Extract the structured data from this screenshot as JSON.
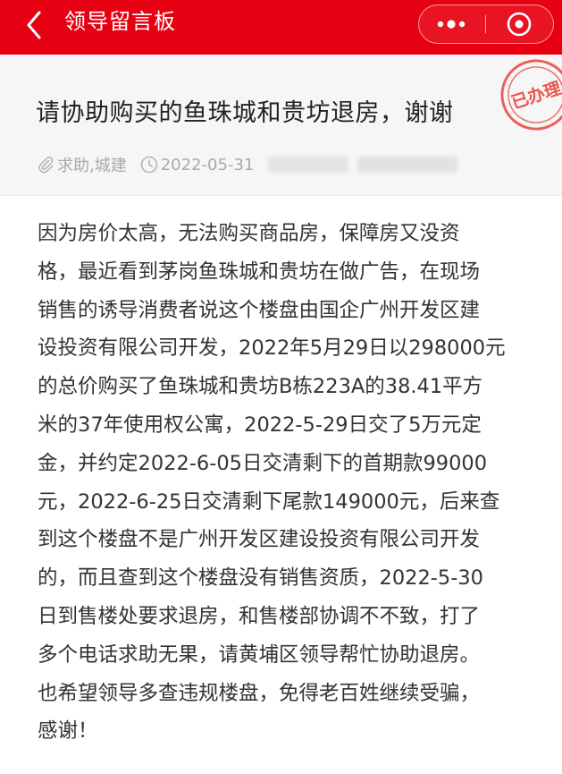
{
  "nav": {
    "title": "领导留言板",
    "back_icon": "chevron-left-icon",
    "more_icon": "more-dots-icon",
    "close_icon": "target-close-icon",
    "bar_color": "#e60012"
  },
  "post": {
    "title": "请协助购买的鱼珠城和贵坊退房，谢谢",
    "tags": "求助,城建",
    "date": "2022-05-31",
    "stamp_text": "已办理",
    "stamp_color": "#e8453c",
    "body_lines": [
      "因为房价太高，无法购买商品房，保障房又没资",
      "格，最近看到茅岗鱼珠城和贵坊在做广告，在现场",
      "销售的诱导消费者说这个楼盘由国企广州开发区建",
      "设投资有限公司开发，2022年5月29日以298000元",
      "的总价购买了鱼珠城和贵坊B栋223A的38.41平方",
      "米的37年使用权公寓，2022-5-29日交了5万元定",
      "金，并约定2022-6-05日交清剩下的首期款99000",
      "元，2022-6-25日交清剩下尾款149000元，后来查",
      "到这个楼盘不是广州开发区建设投资有限公司开发",
      "的，而且查到这个楼盘没有销售资质，2022-5-30",
      "日到售楼处要求退房，和售楼部协调不不致，打了",
      "多个电话求助无果，请黄埔区领导帮忙协助退房。",
      "也希望领导多查违规楼盘，免得老百姓继续受骗，",
      "感谢！"
    ]
  }
}
